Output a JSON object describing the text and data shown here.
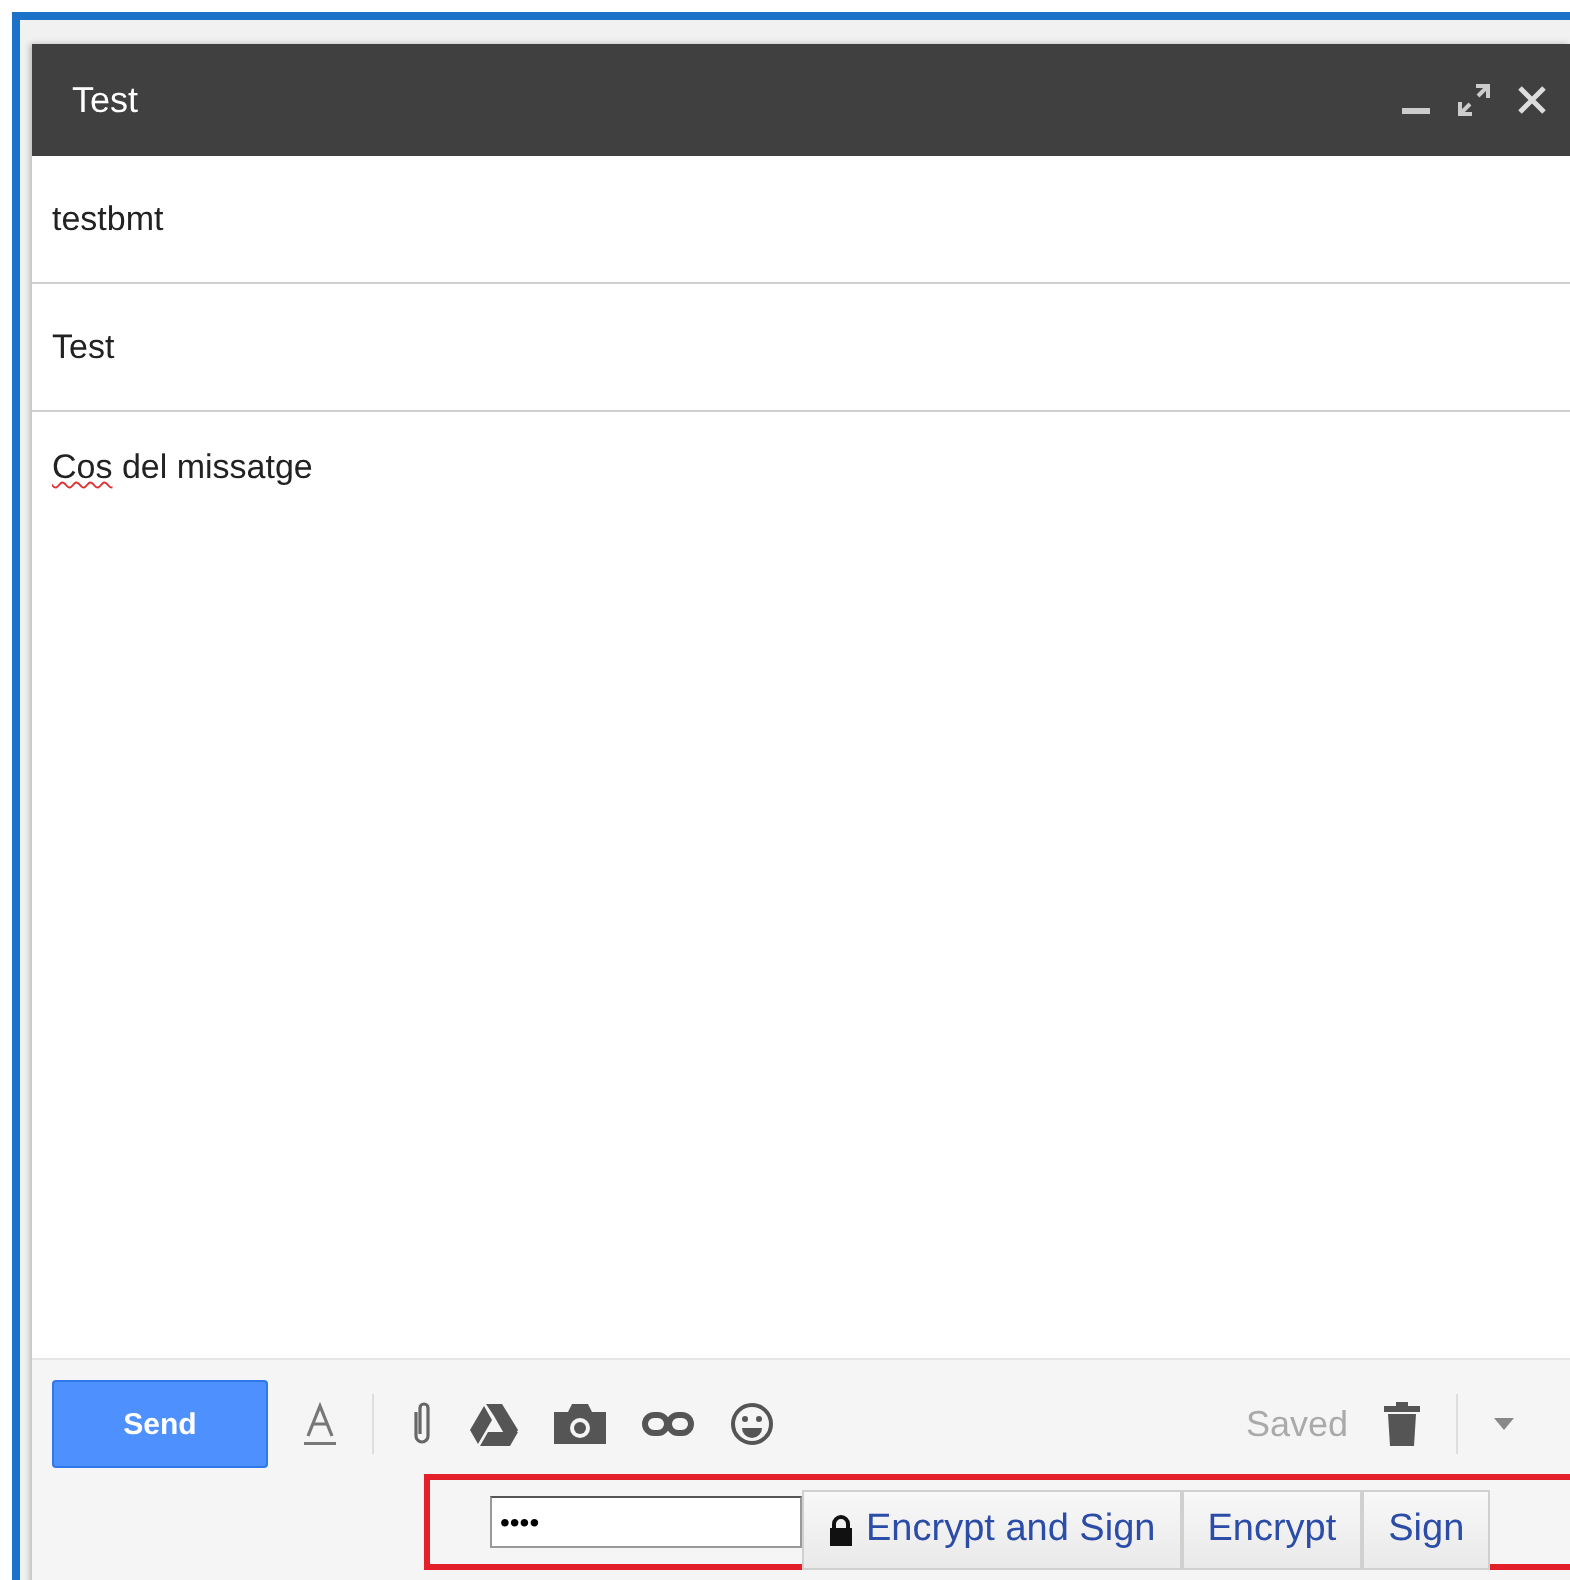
{
  "window": {
    "title": "Test"
  },
  "recipients": {
    "value": "testbmt"
  },
  "subject": {
    "value": "Test"
  },
  "body": {
    "segments": [
      {
        "text": "Cos",
        "misspelled": true
      },
      {
        "text": " del missatge",
        "misspelled": false
      }
    ]
  },
  "toolbar": {
    "send": "Send",
    "status": "Saved"
  },
  "encryption": {
    "password": "••••",
    "buttons": [
      {
        "label": "Encrypt and Sign",
        "kind": "lock"
      },
      {
        "label": "Encrypt",
        "kind": "plain"
      },
      {
        "label": "Sign",
        "kind": "plain"
      }
    ]
  }
}
